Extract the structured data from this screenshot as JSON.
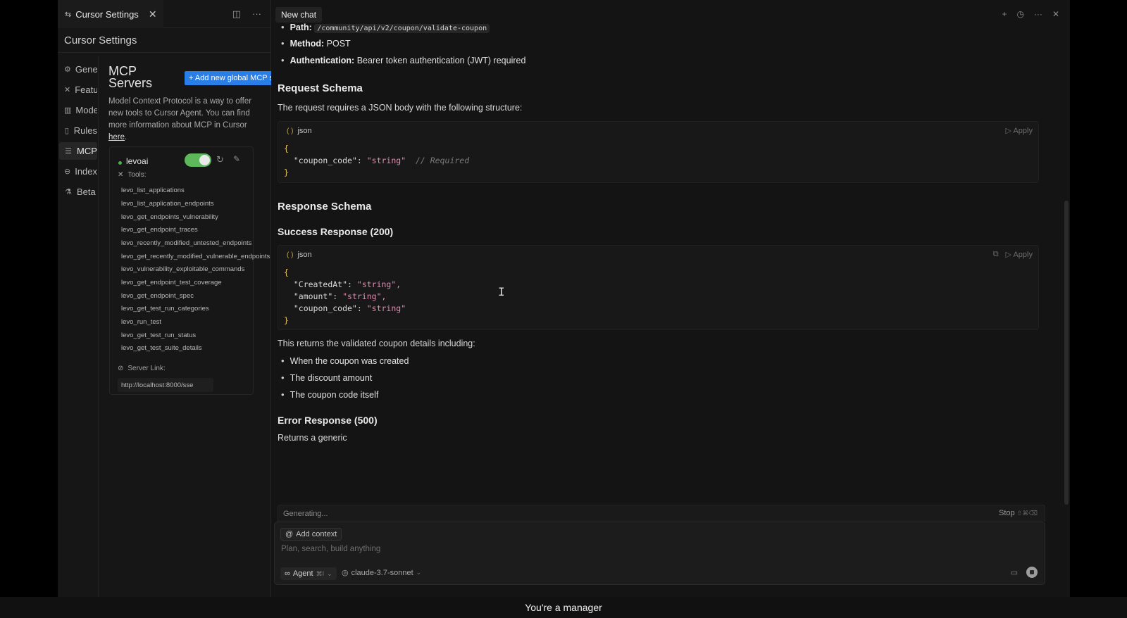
{
  "settings": {
    "tab_label": "Cursor Settings",
    "title": "Cursor Settings",
    "nav": [
      {
        "label": "General",
        "icon": "gear-icon"
      },
      {
        "label": "Features",
        "icon": "tools-icon"
      },
      {
        "label": "Models",
        "icon": "models-icon"
      },
      {
        "label": "Rules",
        "icon": "rules-icon"
      },
      {
        "label": "MCP",
        "icon": "mcp-icon"
      },
      {
        "label": "Indexing",
        "icon": "database-icon"
      },
      {
        "label": "Beta",
        "icon": "flask-icon"
      }
    ],
    "mcp": {
      "title": "MCP Servers",
      "add_button": "+ Add new global MCP server",
      "description": "Model Context Protocol is a way to offer new tools to Cursor Agent. You can find more information about MCP in Cursor ",
      "description_link": "here",
      "description_end": ".",
      "server": {
        "name": "levoai",
        "enabled": true,
        "tools_label": "Tools:",
        "tools": [
          "levo_list_applications",
          "levo_list_application_endpoints",
          "levo_get_endpoints_vulnerability",
          "levo_get_endpoint_traces",
          "levo_recently_modified_untested_endpoints",
          "levo_get_recently_modified_vulnerable_endpoints",
          "levo_vulnerability_exploitable_commands",
          "levo_get_endpoint_test_coverage",
          "levo_get_endpoint_spec",
          "levo_get_test_run_categories",
          "levo_run_test",
          "levo_get_test_run_status",
          "levo_get_test_suite_details"
        ],
        "link_label": "Server Link:",
        "link": "http://localhost:8000/sse"
      }
    }
  },
  "chat": {
    "tab_label": "New chat",
    "path_label": "Path:",
    "path_value": "/community/api/v2/coupon/validate-coupon",
    "method_label": "Method:",
    "method_value": "POST",
    "auth_label": "Authentication:",
    "auth_value": "Bearer token authentication (JWT) required",
    "request_heading": "Request Schema",
    "request_text": "The request requires a JSON body with the following structure:",
    "code_lang": "json",
    "apply_label": "Apply",
    "request_code": {
      "key": "\"coupon_code\"",
      "value": "\"string\"",
      "comment": "// Required"
    },
    "response_heading": "Response Schema",
    "success_heading": "Success Response (200)",
    "response_code": [
      {
        "key": "\"CreatedAt\"",
        "value": "\"string\","
      },
      {
        "key": "\"amount\"",
        "value": "\"string\","
      },
      {
        "key": "\"coupon_code\"",
        "value": "\"string\""
      }
    ],
    "returns_text": "This returns the validated coupon details including:",
    "returns_items": [
      "When the coupon was created",
      "The discount amount",
      "The coupon code itself"
    ],
    "error_heading": "Error Response (500)",
    "error_text": "Returns a generic",
    "generating": "Generating...",
    "stop_label": "Stop",
    "stop_shortcut": "⇧⌘⌫",
    "add_context": "Add context",
    "input_placeholder": "Plan, search, build anything",
    "agent_label": "Agent",
    "agent_shortcut": "⌘I",
    "model": "claude-3.7-sonnet"
  },
  "caption": "You're a manager"
}
